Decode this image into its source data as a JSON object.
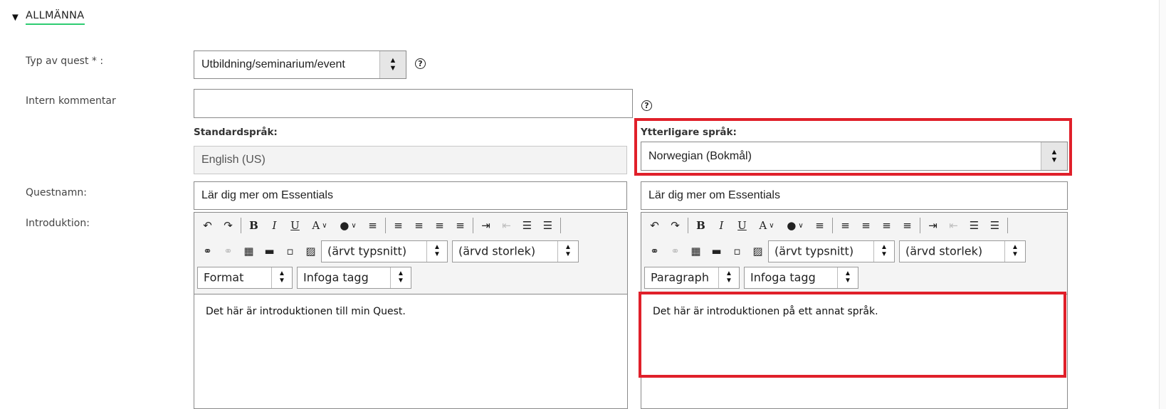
{
  "section": {
    "title": "ALLMÄNNA",
    "caret": "▼"
  },
  "labels": {
    "quest_type": "Typ av quest * :",
    "internal_comment": "Intern kommentar",
    "standard_language": "Standardspråk:",
    "additional_language": "Ytterligare språk:",
    "quest_name": "Questnamn:",
    "introduction": "Introduktion:"
  },
  "fields": {
    "quest_type_value": "Utbildning/seminarium/event",
    "internal_comment_value": "",
    "standard_language_value": "English (US)",
    "additional_language_value": "Norwegian (Bokmål)",
    "quest_name_default": "Lär dig mer om Essentials",
    "quest_name_additional": "Lär dig mer om Essentials"
  },
  "help_glyph": "?",
  "editor": {
    "font_family_value": "(ärvt typsnitt)",
    "font_size_value": "(ärvd storlek)",
    "format_value_left": "Format",
    "format_value_right": "Paragraph",
    "insert_tag_value": "Infoga tagg",
    "content_left": "Det här är introduktionen till min Quest.",
    "content_right": "Det här är introduktionen på ett annat språk."
  },
  "colors": {
    "accent_underline": "#2ecc71",
    "highlight": "#e0202a"
  }
}
